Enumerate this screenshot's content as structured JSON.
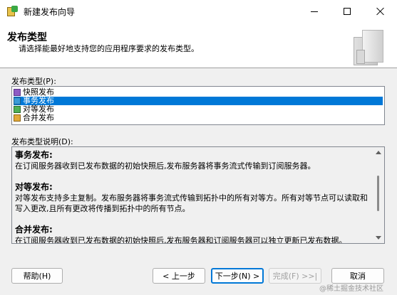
{
  "window": {
    "title": "新建发布向导"
  },
  "header": {
    "title": "发布类型",
    "subtitle": "请选择能最好地支持您的应用程序要求的发布类型。"
  },
  "type_list": {
    "label": "发布类型(P):",
    "items": [
      {
        "label": "快照发布",
        "icon": "snapshot-icon",
        "selected": false
      },
      {
        "label": "事务发布",
        "icon": "transactional-icon",
        "selected": true
      },
      {
        "label": "对等发布",
        "icon": "peer-to-peer-icon",
        "selected": false
      },
      {
        "label": "合并发布",
        "icon": "merge-icon",
        "selected": false
      }
    ]
  },
  "description": {
    "label": "发布类型说明(D):",
    "sections": [
      {
        "heading": "事务发布:",
        "text": "在订阅服务器收到已发布数据的初始快照后,发布服务器将事务流式传输到订阅服务器。"
      },
      {
        "heading": "对等发布:",
        "text": "对等发布支持多主复制。发布服务器将事务流式传输到拓扑中的所有对等方。所有对等节点可以读取和写入更改,且所有更改将传播到拓扑中的所有节点。"
      },
      {
        "heading": "合并发布:",
        "text": "在订阅服务器收到已发布数据的初始快照后,发布服务器和订阅服务器可以独立更新已发布数据。"
      }
    ]
  },
  "buttons": {
    "help": "帮助(H)",
    "back": "< 上一步",
    "next": "下一步(N) >",
    "finish": "完成(F) >>|",
    "cancel": "取消"
  },
  "watermark": "@稀土掘金技术社区",
  "colors": {
    "selection": "#0078d7",
    "background": "#f0f0f0"
  }
}
